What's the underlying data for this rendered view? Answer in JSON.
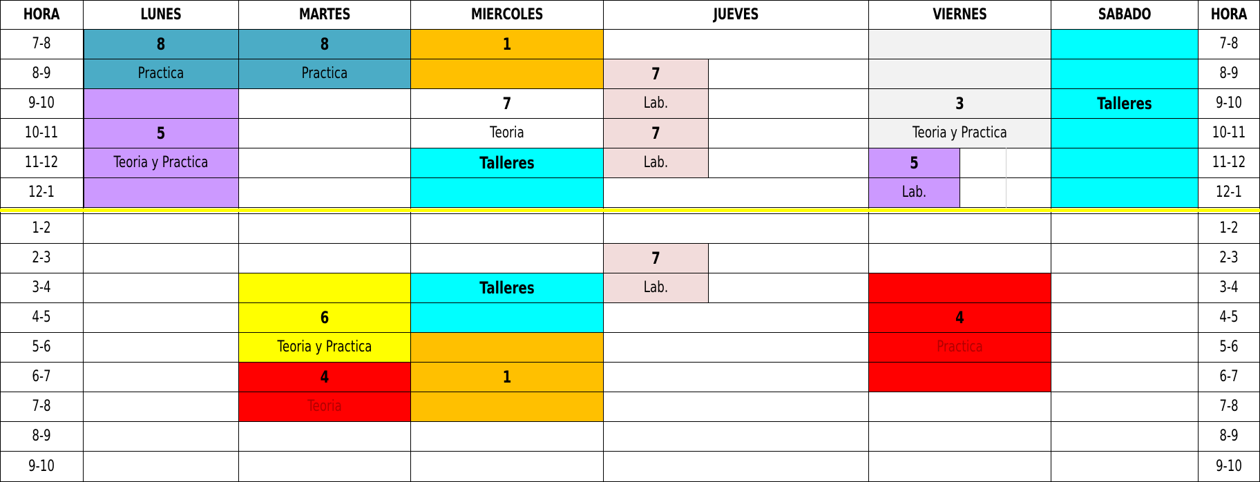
{
  "header": {
    "hora_left": "HORA",
    "days": [
      "LUNES",
      "MARTES",
      "MIERCOLES",
      "JUEVES",
      "VIERNES",
      "SABADO"
    ],
    "hora_right": "HORA"
  },
  "hours": [
    "7-8",
    "8-9",
    "9-10",
    "10-11",
    "11-12",
    "12-1",
    "1-2",
    "2-3",
    "3-4",
    "4-5",
    "5-6",
    "6-7",
    "7-8",
    "8-9",
    "9-10"
  ],
  "colors": {
    "teal": "#4bacc6",
    "orange": "#ffc000",
    "purple": "#cc99ff",
    "pink": "#f2dcdb",
    "grey": "#f2f2f2",
    "cyan": "#00ffff",
    "yellow": "#ffff00",
    "red": "#ff0000",
    "separator": "#ffff00"
  },
  "blocks": {
    "lunes_practica": {
      "num": "8",
      "label": "Practica"
    },
    "martes_practica": {
      "num": "8",
      "label": "Practica"
    },
    "miercoles_1_am": {
      "num": "1"
    },
    "lunes_teoria_practica": {
      "num": "5",
      "label": "Teoria y Practica"
    },
    "miercoles_teoria": {
      "num": "7",
      "label": "Teoria"
    },
    "miercoles_talleres_am": {
      "label": "Talleres"
    },
    "jueves_lab_1": {
      "num": "7",
      "label": "Lab."
    },
    "jueves_lab_2": {
      "num": "7",
      "label": "Lab."
    },
    "viernes_teoria_practica": {
      "num": "3",
      "label": "Teoria y Practica"
    },
    "viernes_lab": {
      "num": "5",
      "label": "Lab."
    },
    "sabado_talleres": {
      "label": "Talleres"
    },
    "jueves_lab_pm": {
      "num": "7",
      "label": "Lab."
    },
    "martes_teoria_practica_pm": {
      "num": "6",
      "label": "Teoria y Practica"
    },
    "miercoles_talleres_pm": {
      "label": "Talleres"
    },
    "viernes_practica": {
      "num": "4",
      "label": "Practica"
    },
    "miercoles_1_pm": {
      "num": "1"
    },
    "martes_teoria": {
      "num": "4",
      "label": "Teoria"
    }
  }
}
